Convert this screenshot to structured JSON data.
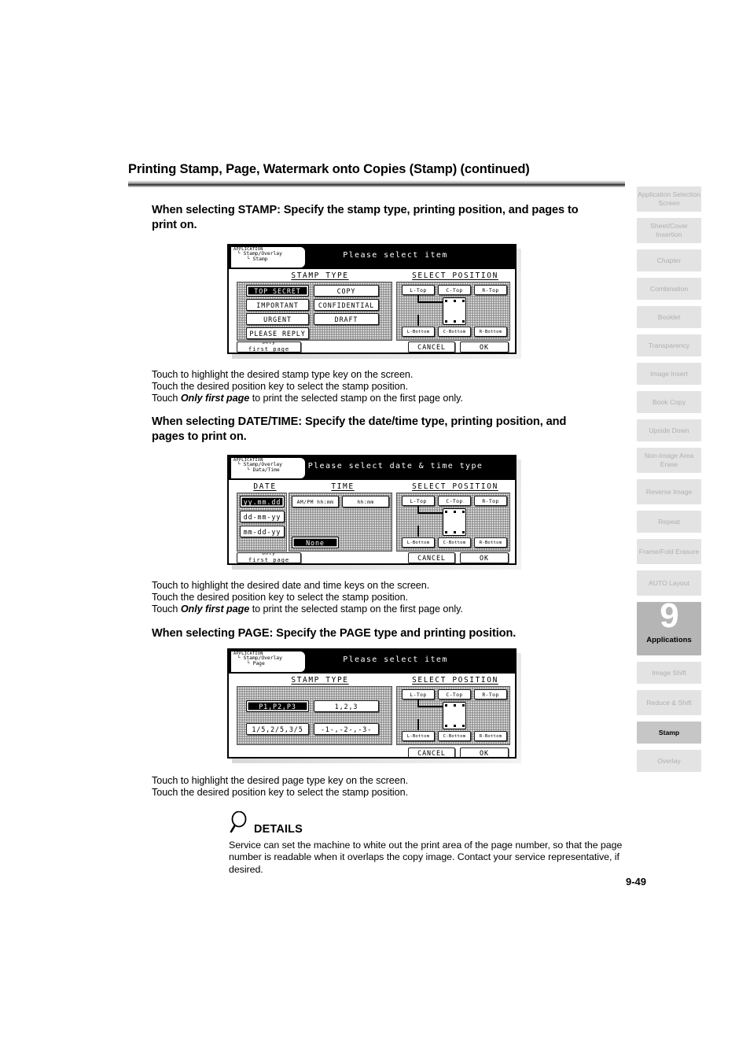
{
  "page": {
    "title": "Printing Stamp, Page, Watermark onto Copies (Stamp) (continued)",
    "number": "9-49"
  },
  "sections": [
    {
      "heading": "When selecting STAMP: Specify the stamp type, printing position,  and pages to print on.",
      "notes": [
        {
          "pre": "Touch to highlight the desired stamp type key on the screen.",
          "bold": "",
          "post": ""
        },
        {
          "pre": "Touch the desired position key to select the stamp position.",
          "bold": "",
          "post": ""
        },
        {
          "pre": "Touch ",
          "bold": "Only first page",
          "post": " to print the selected stamp on the first page only."
        }
      ]
    },
    {
      "heading": "When selecting DATE/TIME: Specify the date/time type, printing position, and pages to print on.",
      "notes": [
        {
          "pre": "Touch to highlight the desired date and time keys on the screen.",
          "bold": "",
          "post": ""
        },
        {
          "pre": "Touch the desired position key to select the stamp position.",
          "bold": "",
          "post": ""
        },
        {
          "pre": "Touch ",
          "bold": "Only first page",
          "post": " to print the selected stamp on the first page only."
        }
      ]
    },
    {
      "heading": "When selecting PAGE: Specify the PAGE type and printing position.",
      "notes": [
        {
          "pre": "Touch to highlight the desired page type key on the screen.",
          "bold": "",
          "post": ""
        },
        {
          "pre": "Touch the desired position key to select the stamp position.",
          "bold": "",
          "post": ""
        }
      ]
    }
  ],
  "lcd_stamp": {
    "crumb": {
      "l1": "APPLICATION",
      "l2": "└ Stamp/Overlay",
      "l3": "└ Stamp"
    },
    "prompt": "Please select item",
    "col_left_title": "STAMP TYPE",
    "col_right_title": "SELECT POSITION",
    "type_keys": [
      {
        "label": "TOP SECRET",
        "selected": true
      },
      {
        "label": "COPY",
        "selected": false
      },
      {
        "label": "IMPORTANT",
        "selected": false
      },
      {
        "label": "CONFIDENTIAL",
        "selected": false
      },
      {
        "label": "URGENT",
        "selected": false
      },
      {
        "label": "DRAFT",
        "selected": false
      },
      {
        "label": "PLEASE REPLY",
        "selected": false
      }
    ],
    "position_keys": [
      {
        "label": "L-Top",
        "selected": true
      },
      {
        "label": "C-Top",
        "selected": false
      },
      {
        "label": "R-Top",
        "selected": false
      },
      {
        "label": "L-Bottom",
        "selected": false
      },
      {
        "label": "C-Bottom",
        "selected": false
      },
      {
        "label": "R-Bottom",
        "selected": false
      }
    ],
    "only_first_page": {
      "l1": "Only",
      "l2": "first page"
    },
    "cancel": "CANCEL",
    "ok": "OK"
  },
  "lcd_datetime": {
    "crumb": {
      "l1": "APPLICATION",
      "l2": "└ Stamp/Overlay",
      "l3": "└ Data/Time"
    },
    "prompt": "Please select date & time type",
    "col_date_title": "DATE",
    "col_time_title": "TIME",
    "col_right_title": "SELECT POSITION",
    "date_keys": [
      {
        "label": "yy.mm.dd",
        "selected": true
      },
      {
        "label": "dd-mm-yy",
        "selected": false
      },
      {
        "label": "mm-dd-yy",
        "selected": false
      }
    ],
    "time_keys": [
      {
        "label": "AM/PM hh:mm",
        "selected": false
      },
      {
        "label": "hh:mm",
        "selected": false
      },
      {
        "label": "None",
        "selected": true
      }
    ],
    "position_keys": [
      {
        "label": "L-Top",
        "selected": true
      },
      {
        "label": "C-Top",
        "selected": false
      },
      {
        "label": "R-Top",
        "selected": false
      },
      {
        "label": "L-Bottom",
        "selected": false
      },
      {
        "label": "C-Bottom",
        "selected": false
      },
      {
        "label": "R-Bottom",
        "selected": false
      }
    ],
    "only_first_page": {
      "l1": "Only",
      "l2": "first page"
    },
    "cancel": "CANCEL",
    "ok": "OK"
  },
  "lcd_page": {
    "crumb": {
      "l1": "APPLICATION",
      "l2": "└ Stamp/Overlay",
      "l3": "└ Page"
    },
    "prompt": "Please select item",
    "col_left_title": "STAMP TYPE",
    "col_right_title": "SELECT POSITION",
    "type_keys": [
      {
        "label": "P1,P2,P3",
        "selected": true
      },
      {
        "label": "1,2,3",
        "selected": false
      },
      {
        "label": "1/5,2/5,3/5",
        "selected": false
      },
      {
        "label": "-1-,-2-,-3-",
        "selected": false
      }
    ],
    "position_keys": [
      {
        "label": "L-Top",
        "selected": true
      },
      {
        "label": "C-Top",
        "selected": false
      },
      {
        "label": "R-Top",
        "selected": false
      },
      {
        "label": "L-Bottom",
        "selected": false
      },
      {
        "label": "C-Bottom",
        "selected": false
      },
      {
        "label": "R-Bottom",
        "selected": false
      }
    ],
    "cancel": "CANCEL",
    "ok": "OK"
  },
  "details": {
    "icon": "magnifier-icon",
    "label": "DETAILS",
    "text": "Service can set the machine to white out the print area of the page number, so that the page number is readable when it overlaps the copy image. Contact your service representative, if desired."
  },
  "sidebar": {
    "items": [
      {
        "label": "Application Selection Screen",
        "state": "normal",
        "lines": 2
      },
      {
        "label": "Sheet/Cover Insertion",
        "state": "normal",
        "lines": 2
      },
      {
        "label": "Chapter",
        "state": "normal",
        "lines": 1
      },
      {
        "label": "Combination",
        "state": "normal",
        "lines": 1
      },
      {
        "label": "Booklet",
        "state": "normal",
        "lines": 1
      },
      {
        "label": "Transparency",
        "state": "normal",
        "lines": 1
      },
      {
        "label": "Image Insert",
        "state": "normal",
        "lines": 1
      },
      {
        "label": "Book Copy",
        "state": "normal",
        "lines": 1
      },
      {
        "label": "Upside Down",
        "state": "normal",
        "lines": 1
      },
      {
        "label": "Non-Image Area Erase",
        "state": "normal",
        "lines": 2
      },
      {
        "label": "Reverse Image",
        "state": "normal",
        "lines": 2
      },
      {
        "label": "Repeat",
        "state": "normal",
        "lines": 1
      },
      {
        "label": "Frame/Fold Erasure",
        "state": "normal",
        "lines": 2
      },
      {
        "label": "AUTO Layout",
        "state": "normal",
        "lines": 2
      },
      {
        "label": "Applications",
        "state": "current",
        "chapter_number": "9",
        "lines": 1
      },
      {
        "label": "Image Shift",
        "state": "normal",
        "lines": 1
      },
      {
        "label": "Reduce & Shift",
        "state": "normal",
        "lines": 2
      },
      {
        "label": "Stamp",
        "state": "active-sub",
        "lines": 1
      },
      {
        "label": "Overlay",
        "state": "normal",
        "lines": 1
      }
    ]
  },
  "colors": {
    "tab_normal_bg": "#e3e3e3",
    "tab_normal_text": "#b0b0b0",
    "tab_current_bg": "#b5b5b5",
    "tab_active_bg": "#c6c6c6",
    "lcd_panel_bg": "#b6b6b6",
    "lcd_selected_bg": "#000000"
  }
}
